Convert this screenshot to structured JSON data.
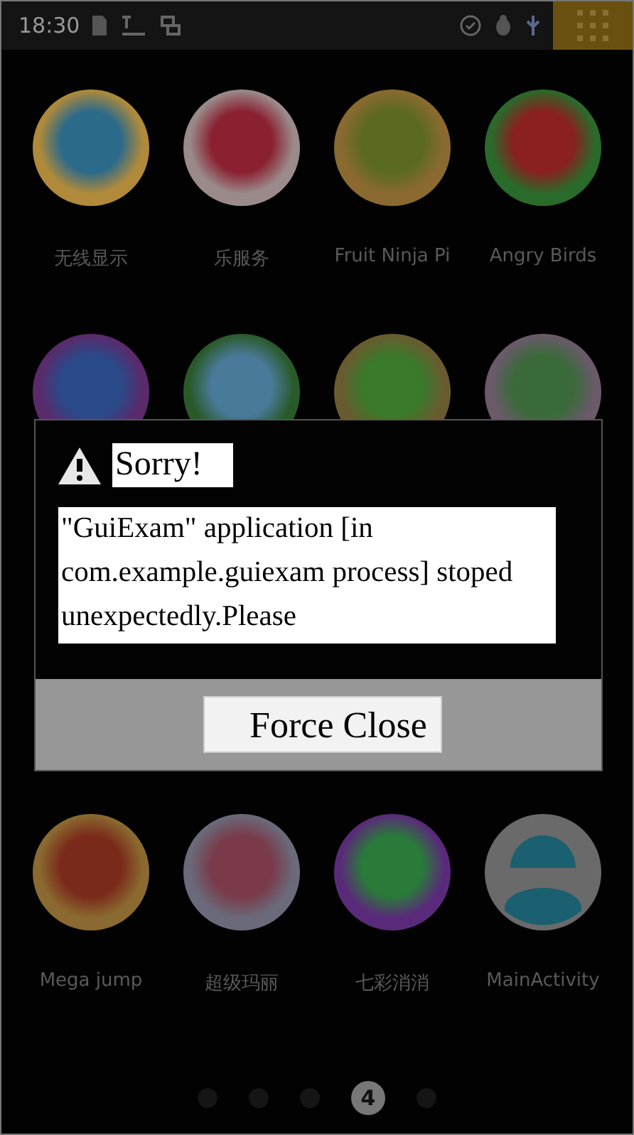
{
  "status_bar": {
    "time": "18:30"
  },
  "app_rows": [
    {
      "apps": [
        {
          "kind": "app",
          "label": "无线显示"
        },
        {
          "kind": "app",
          "label": "乐服务"
        },
        {
          "kind": "app",
          "label": "Fruit Ninja Pi"
        },
        {
          "kind": "app",
          "label": "Angry Birds"
        }
      ]
    },
    {
      "apps": [
        {
          "kind": "app"
        },
        {
          "kind": "app"
        },
        {
          "kind": "app"
        },
        {
          "kind": "app"
        }
      ]
    },
    {
      "apps": [
        {
          "kind": "app",
          "label": "Mega jump"
        },
        {
          "kind": "app",
          "label": "超级玛丽"
        },
        {
          "kind": "app",
          "label": "七彩消消"
        },
        {
          "kind": "avatar",
          "label": "MainActivity"
        }
      ]
    }
  ],
  "dialog": {
    "title": "Sorry!",
    "message": "\"GuiExam\" application [in com.example.guiexam process] stoped unexpectedly.Please",
    "button": "Force Close"
  },
  "page_indicator": [
    {
      "selected": false
    },
    {
      "selected": false
    },
    {
      "selected": false
    },
    {
      "selected": true,
      "label": "4"
    },
    {
      "selected": false
    }
  ]
}
